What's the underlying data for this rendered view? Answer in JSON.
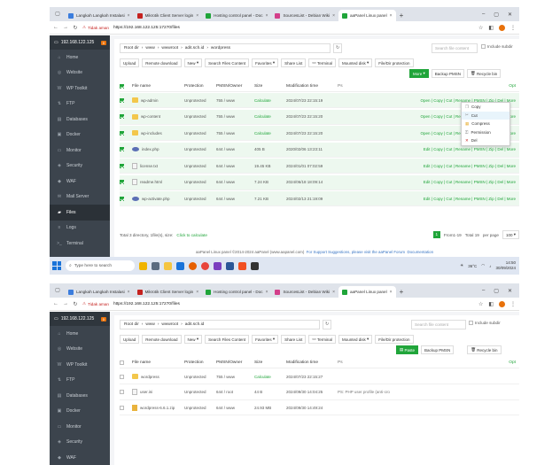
{
  "browser": {
    "tabs": [
      {
        "title": "Langkah Langkah Instalasi",
        "color": "#3b7ddd"
      },
      {
        "title": "Mikrotik Client Server login",
        "color": "#c5221f"
      },
      {
        "title": "Hosting control panel - Doc",
        "color": "#20a53a"
      },
      {
        "title": "SourcesList - Debian Wiki",
        "color": "#d33f8a"
      },
      {
        "title": "aaPanel Linux panel",
        "color": "#20a53a"
      }
    ],
    "not_secure": "Tidak aman",
    "url": "https://192.168.122.125:17270/files"
  },
  "sidebar": {
    "server": "192.168.122.125",
    "badge": "0",
    "items": [
      {
        "label": "Home",
        "icon": "home-icon",
        "glyph": "⌂"
      },
      {
        "label": "Website",
        "icon": "globe-icon",
        "glyph": "◎"
      },
      {
        "label": "WP Toolkit",
        "icon": "wordpress-icon",
        "glyph": "W"
      },
      {
        "label": "FTP",
        "icon": "ftp-icon",
        "glyph": "⇅"
      },
      {
        "label": "Databases",
        "icon": "database-icon",
        "glyph": "▤"
      },
      {
        "label": "Docker",
        "icon": "docker-icon",
        "glyph": "▣"
      },
      {
        "label": "Monitor",
        "icon": "monitor-icon",
        "glyph": "▭"
      },
      {
        "label": "Security",
        "icon": "shield-icon",
        "glyph": "◈"
      },
      {
        "label": "WAF",
        "icon": "waf-icon",
        "glyph": "◆"
      },
      {
        "label": "Mail Server",
        "icon": "mail-icon",
        "glyph": "✉"
      },
      {
        "label": "Files",
        "icon": "folder-icon",
        "glyph": "▰"
      },
      {
        "label": "Logs",
        "icon": "logs-icon",
        "glyph": "≡"
      },
      {
        "label": "Terminal",
        "icon": "terminal-icon",
        "glyph": ">_"
      }
    ]
  },
  "top": {
    "breadcrumb_a": [
      "Root dir",
      "www",
      "wwwroot",
      "adit.sch.id",
      "wordpress"
    ],
    "breadcrumb_b": [
      "Root dir",
      "www",
      "wwwroot",
      "adit.sch.id"
    ],
    "search_placeholder": "Search file content",
    "include_subdir": "Include subdir",
    "buttons": [
      "Upload",
      "Remote download",
      "New",
      "Search Files Content",
      "Favorites",
      "Share List",
      "Terminal",
      "Mounted disk",
      "File/Dir protection"
    ],
    "more": "More",
    "paste": "Paste",
    "backup": "Backup PMSN",
    "recycle": "Recycle bin"
  },
  "columns": {
    "name": "File name",
    "protection": "Protection",
    "perm": "PMSN/Owner",
    "size": "Size",
    "time": "Modification time",
    "ps": "Ps",
    "ops": "Opt"
  },
  "files_a": [
    {
      "name": "wp-admin",
      "type": "folder",
      "protection": "Unprotected",
      "perm": "755 / www",
      "size": "Calculate",
      "time": "2024/07/23 22:15:19",
      "ps": "",
      "ops": "Open | Copy | Cut | Rename | PMSN | Zip | Del | More"
    },
    {
      "name": "wp-content",
      "type": "folder",
      "protection": "Unprotected",
      "perm": "755 / www",
      "size": "Calculate",
      "time": "2024/07/23 22:15:20",
      "ps": "",
      "ops": "Open | Copy | Cut | Rename | PMSN | Zip | Del | More"
    },
    {
      "name": "wp-includes",
      "type": "folder",
      "protection": "Unprotected",
      "perm": "755 / www",
      "size": "Calculate",
      "time": "2024/07/23 22:15:20",
      "ps": "",
      "ops": "Open | Copy | Cut | Rename | PMSN | Zip | Del | More"
    },
    {
      "name": "index.php",
      "type": "php",
      "protection": "Unprotected",
      "perm": "644 / www",
      "size": "405 B",
      "time": "2020/02/06 13:23:11",
      "ps": "",
      "ops": "Edit | Copy | Cut | Rename | PMSN | Zip | Del | More"
    },
    {
      "name": "license.txt",
      "type": "file",
      "protection": "Unprotected",
      "perm": "644 / www",
      "size": "19.45 KB",
      "time": "2024/01/01 07:02:59",
      "ps": "",
      "ops": "Edit | Copy | Cut | Rename | PMSN | Zip | Del | More"
    },
    {
      "name": "readme.html",
      "type": "file",
      "protection": "Unprotected",
      "perm": "644 / www",
      "size": "7.24 KB",
      "time": "2024/06/18 18:09:14",
      "ps": "",
      "ops": "Edit | Copy | Cut | Rename | PMSN | Zip | Del | More"
    },
    {
      "name": "wp-activate.php",
      "type": "php",
      "protection": "Unprotected",
      "perm": "644 / www",
      "size": "7.21 KB",
      "time": "2024/02/13 21:19:09",
      "ps": "",
      "ops": "Edit | Copy | Cut | Rename | PMSN | Zip | Del | More"
    }
  ],
  "files_b": [
    {
      "name": "wordpress",
      "type": "folder",
      "protection": "Unprotected",
      "perm": "755 / www",
      "size": "Calculate",
      "time": "2024/07/23 22:15:27",
      "ps": ""
    },
    {
      "name": "user.ini",
      "type": "file",
      "protection": "Unprotected",
      "perm": "644 / root",
      "size": "44 B",
      "time": "2024/09/30 14:04:25",
      "ps": "PS: PHP user profile (anti-cro"
    },
    {
      "name": "wordpress-6.6.1.zip",
      "type": "zip",
      "protection": "Unprotected",
      "perm": "644 / www",
      "size": "24.93 MB",
      "time": "2024/09/30 14:49:24",
      "ps": ""
    }
  ],
  "menu": [
    {
      "label": "Copy",
      "icon": "copy-icon",
      "glyph": "❐",
      "color": "#888"
    },
    {
      "label": "Cut",
      "icon": "cut-icon",
      "glyph": "✂",
      "color": "#888"
    },
    {
      "label": "Compress",
      "icon": "compress-icon",
      "glyph": "▦",
      "color": "#e9b33d"
    },
    {
      "label": "Permission",
      "icon": "permission-icon",
      "glyph": "⚿",
      "color": "#888"
    },
    {
      "label": "Del",
      "icon": "delete-icon",
      "glyph": "✕",
      "color": "#c5221f"
    }
  ],
  "footer": {
    "summary": "Total 3 directory, 1file(s), size:",
    "calc": "Click to calculate",
    "page": "1",
    "range": "From1-19",
    "total": "Total 19",
    "per_page": "per page",
    "per_page_value": "100"
  },
  "bottom": {
    "copyright": "aaPanel Linux panel ©2014-2024 aaPanel (www.aapanel.com)",
    "suggest": "For Support Suggestions, please visit the aaPanel Forum",
    "docs": "Documentation"
  },
  "taskbar": {
    "search": "Type here to search",
    "weather": "36°C",
    "time": "14:50",
    "date": "30/09/2024"
  }
}
